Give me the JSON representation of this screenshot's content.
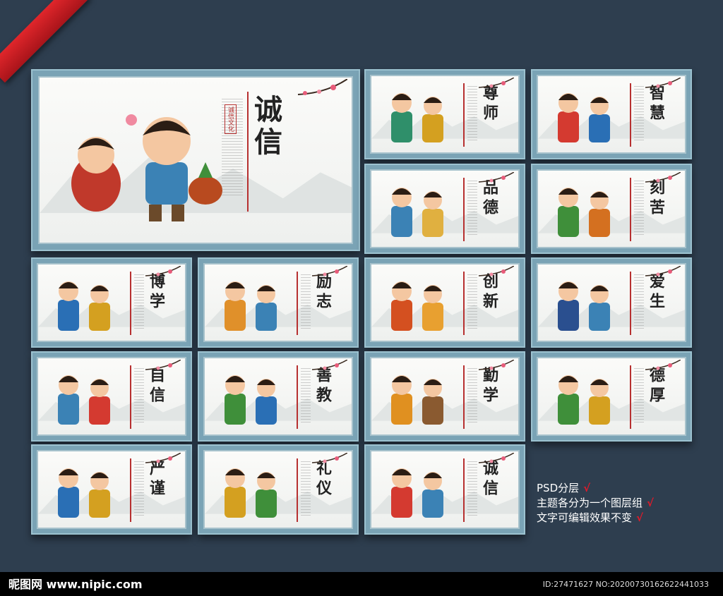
{
  "main_title": "诚信",
  "main_seal": "诚信文化",
  "panels": [
    {
      "title": "尊师"
    },
    {
      "title": "智慧"
    },
    {
      "title": "品德"
    },
    {
      "title": "刻苦"
    },
    {
      "title": "博学"
    },
    {
      "title": "励志"
    },
    {
      "title": "创新"
    },
    {
      "title": "爱生"
    },
    {
      "title": "自信"
    },
    {
      "title": "善教"
    },
    {
      "title": "勤学"
    },
    {
      "title": "德厚"
    },
    {
      "title": "严谨"
    },
    {
      "title": "礼仪"
    },
    {
      "title": "诚信"
    }
  ],
  "notes": {
    "line1": "PSD分层",
    "line2": "主题各分为一个图层组",
    "line3": "文字可编辑效果不变",
    "check": "√"
  },
  "watermark": {
    "logo": "昵图网 www.nipic.com",
    "id": "ID:27471627 NO:20200730162622441033"
  },
  "colors": {
    "frame": "#7aa3b5",
    "background": "#2e3e4f",
    "accent": "#e01a2a"
  }
}
